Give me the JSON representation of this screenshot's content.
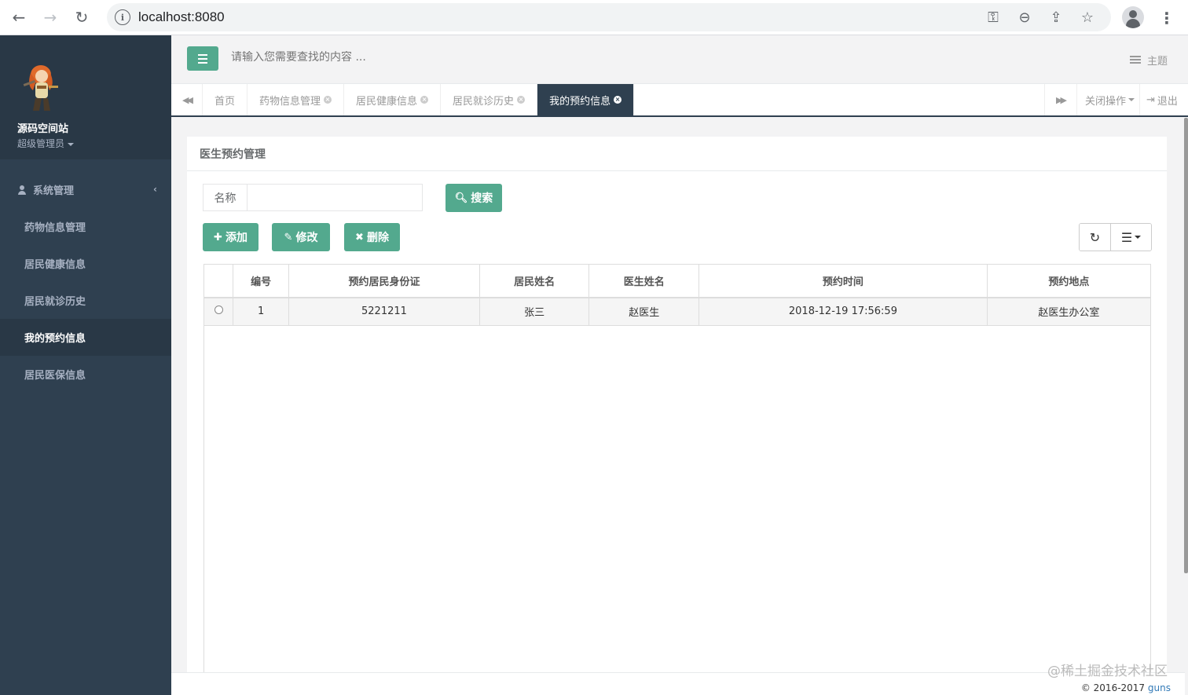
{
  "browser": {
    "url": "localhost:8080",
    "icons": [
      "back-icon",
      "forward-icon",
      "reload-icon",
      "info-icon",
      "key-icon",
      "zoom-out-icon",
      "share-icon",
      "star-icon",
      "profile-icon",
      "more-icon"
    ]
  },
  "sidebar": {
    "user_name": "源码空间站",
    "user_role": "超级管理员",
    "group_label": "系统管理",
    "items": [
      {
        "label": "药物信息管理"
      },
      {
        "label": "居民健康信息"
      },
      {
        "label": "居民就诊历史"
      },
      {
        "label": "我的预约信息"
      },
      {
        "label": "居民医保信息"
      }
    ]
  },
  "header": {
    "search_placeholder": "请输入您需要查找的内容 ...",
    "theme_label": "主题"
  },
  "tabs": {
    "items": [
      {
        "label": "首页"
      },
      {
        "label": "药物信息管理"
      },
      {
        "label": "居民健康信息"
      },
      {
        "label": "居民就诊历史"
      },
      {
        "label": "我的预约信息"
      }
    ],
    "close_ops_label": "关闭操作",
    "logout_label": "退出"
  },
  "panel": {
    "title": "医生预约管理",
    "search_label": "名称",
    "search_value": "",
    "search_button": "搜索",
    "add_button": "添加",
    "edit_button": "修改",
    "delete_button": "删除"
  },
  "table": {
    "columns": [
      "编号",
      "预约居民身份证",
      "居民姓名",
      "医生姓名",
      "预约时间",
      "预约地点"
    ],
    "rows": [
      {
        "id": "1",
        "resident_id": "5221211",
        "resident_name": "张三",
        "doctor_name": "赵医生",
        "time": "2018-12-19 17:56:59",
        "location": "赵医生办公室"
      }
    ]
  },
  "footer": {
    "watermark": "@稀土掘金技术社区",
    "copyright": "© 2016-2017",
    "link": "guns"
  },
  "colors": {
    "sidebar_bg": "#2f4050",
    "accent_green": "#53a98e",
    "active_tab_bg": "#2f4050"
  }
}
